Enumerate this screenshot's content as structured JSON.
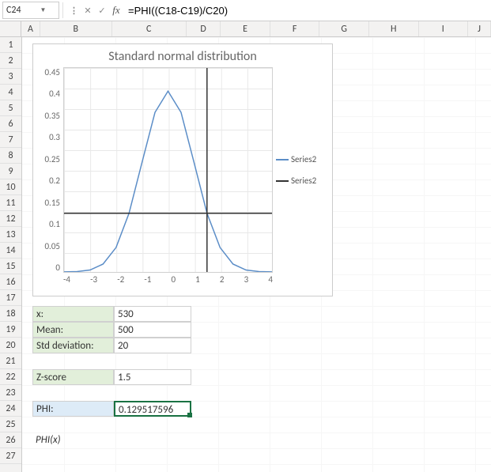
{
  "formula_bar": {
    "cell_ref": "C24",
    "formula": "=PHI((C18-C19)/C20)"
  },
  "columns": [
    "A",
    "B",
    "C",
    "D",
    "E",
    "F",
    "G",
    "H",
    "I",
    "J"
  ],
  "rows": [
    "1",
    "2",
    "3",
    "4",
    "5",
    "6",
    "7",
    "8",
    "9",
    "10",
    "11",
    "12",
    "13",
    "14",
    "15",
    "16",
    "17",
    "18",
    "19",
    "20",
    "21",
    "22",
    "23",
    "24",
    "25",
    "26",
    "27"
  ],
  "sheet": {
    "r18": {
      "label": "x:",
      "value": "530"
    },
    "r19": {
      "label": "Mean:",
      "value": "500"
    },
    "r20": {
      "label": "Std deviation:",
      "value": "20"
    },
    "r22": {
      "label": "Z-score",
      "value": "1.5"
    },
    "r24": {
      "label": "PHI:",
      "value": "0.129517596"
    },
    "r26": {
      "note": "PHI(x)"
    }
  },
  "chart_data": {
    "type": "line",
    "title": "Standard normal distribution",
    "xlabel": "",
    "ylabel": "",
    "x_ticks": [
      "-4",
      "-3",
      "-2",
      "-1",
      "0",
      "1",
      "2",
      "3",
      "4"
    ],
    "y_ticks": [
      "0.45",
      "0.4",
      "0.35",
      "0.3",
      "0.25",
      "0.2",
      "0.15",
      "0.1",
      "0.05",
      "0"
    ],
    "xlim": [
      -4,
      4
    ],
    "ylim": [
      0,
      0.45
    ],
    "legend": [
      "Series2",
      "Series2"
    ],
    "series": [
      {
        "name": "Series2",
        "type": "line",
        "color": "#5b8dc7",
        "x": [
          -4,
          -3.5,
          -3,
          -2.5,
          -2,
          -1.5,
          -1,
          -0.5,
          0,
          0.5,
          1,
          1.5,
          2,
          2.5,
          3,
          3.5,
          4
        ],
        "values": [
          0.0001,
          0.0009,
          0.0044,
          0.0175,
          0.054,
          0.1295,
          0.242,
          0.3521,
          0.3989,
          0.3521,
          0.242,
          0.1295,
          0.054,
          0.0175,
          0.0044,
          0.0009,
          0.0001
        ]
      },
      {
        "name": "Series2",
        "type": "cross",
        "color": "#333333",
        "vline_x": 1.5,
        "hline_y": 0.1295
      }
    ]
  }
}
